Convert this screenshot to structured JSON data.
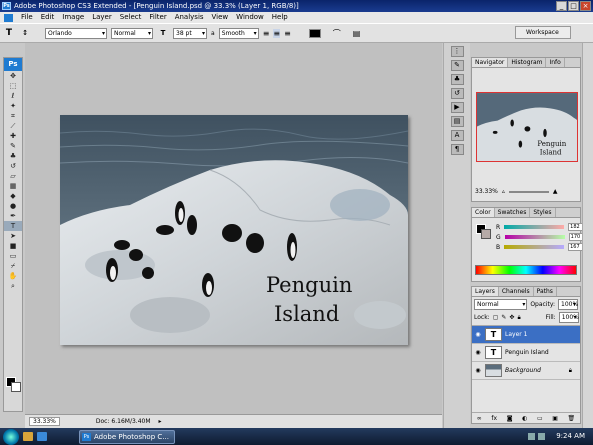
{
  "window": {
    "title": "Adobe Photoshop CS3 Extended - [Penguin Island.psd @ 33.3% (Layer 1, RGB/8)]"
  },
  "menu": [
    "File",
    "Edit",
    "Image",
    "Layer",
    "Select",
    "Filter",
    "Analysis",
    "View",
    "Window",
    "Help"
  ],
  "options": {
    "font_family": "Orlando",
    "font_style": "Normal",
    "font_size": "38 pt",
    "aa_label": "a",
    "antialias": "Smooth",
    "workspace": "Workspace"
  },
  "document": {
    "title_line1": "Penguin",
    "title_line2": "Island"
  },
  "status": {
    "zoom": "33.33%",
    "doc_size": "Doc: 6.16M/3.40M"
  },
  "navigator": {
    "tabs": [
      "Navigator",
      "Histogram",
      "Info"
    ],
    "zoom": "33.33%"
  },
  "color_panel": {
    "tabs": [
      "Color",
      "Swatches",
      "Styles"
    ],
    "r": "182",
    "g": "170",
    "b": "167",
    "r_label": "R",
    "g_label": "G",
    "b_label": "B"
  },
  "layers_panel": {
    "tabs": [
      "Layers",
      "Channels",
      "Paths"
    ],
    "blend_mode": "Normal",
    "opacity_label": "Opacity:",
    "opacity": "100%",
    "lock_label": "Lock:",
    "fill_label": "Fill:",
    "fill": "100%",
    "layers": [
      {
        "name": "Layer 1",
        "thumb": "T",
        "selected": true
      },
      {
        "name": "Penguin Island",
        "thumb": "T",
        "selected": false
      },
      {
        "name": "Background",
        "thumb": "",
        "selected": false
      }
    ]
  },
  "taskbar": {
    "app_button": "Adobe Photoshop C...",
    "clock": "9:24 AM"
  },
  "toolbox": {
    "logo": "Ps"
  }
}
